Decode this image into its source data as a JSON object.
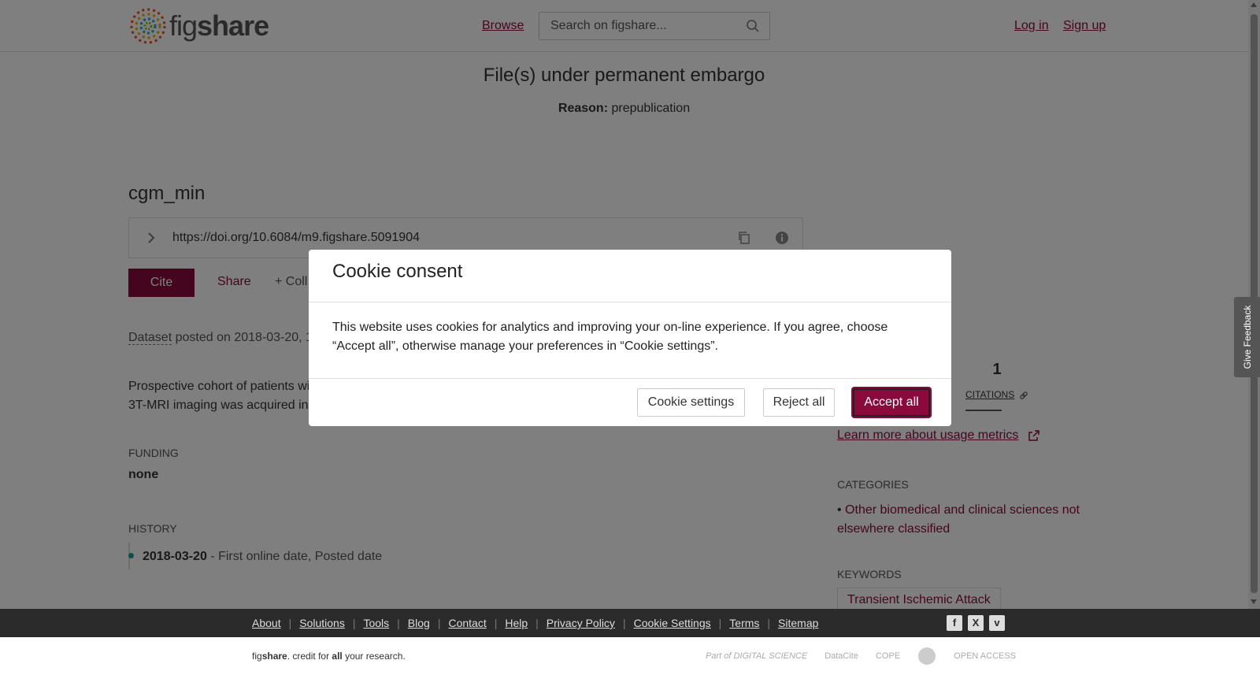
{
  "header": {
    "logo_text_fig": "fig",
    "logo_text_share": "share",
    "browse": "Browse",
    "search_placeholder": "Search on figshare...",
    "login": "Log in",
    "signup": "Sign up"
  },
  "embargo": {
    "title": "File(s) under permanent embargo",
    "reason_label": "Reason:",
    "reason_value": "prepublication"
  },
  "item": {
    "title": "cgm_min",
    "doi": "https://doi.org/10.6084/m9.figshare.5091904",
    "actions": {
      "cite": "Cite",
      "share": "Share",
      "collect": "+ Coll"
    },
    "type": "Dataset",
    "posted_prefix": " posted on 2018-03-20, 1",
    "description_lines": [
      "Prospective cohort of patients wi",
      "3T-MRI imaging was acquired in"
    ]
  },
  "funding": {
    "label": "FUNDING",
    "value": "none"
  },
  "history": {
    "label": "HISTORY",
    "date": "2018-03-20",
    "desc": " - First online date, Posted date"
  },
  "metrics": {
    "citations_count": "1",
    "citations_label": "CITATIONS",
    "learn_more": "Learn more about usage metrics"
  },
  "categories": {
    "label": "CATEGORIES",
    "item": "Other biomedical and clinical sciences not elsewhere classified"
  },
  "keywords": {
    "label": "KEYWORDS",
    "item": "Transient Ischemic Attack"
  },
  "feedback": "Give Feedback",
  "cookie": {
    "title": "Cookie consent",
    "body": "This website uses cookies for analytics and improving your on-line experience. If you agree, choose “Accept all”, otherwise manage your preferences in “Cookie settings”.",
    "settings": "Cookie settings",
    "reject": "Reject all",
    "accept": "Accept all"
  },
  "footer": {
    "links": [
      "About",
      "Solutions",
      "Tools",
      "Blog",
      "Contact",
      "Help",
      "Privacy Policy",
      "Cookie Settings",
      "Terms",
      "Sitemap"
    ],
    "social": [
      "f",
      "X",
      "v"
    ],
    "tagline_pre": "fig",
    "tagline_brand": "share",
    "tagline_mid": ". credit for ",
    "tagline_all": "all",
    "tagline_post": " your research.",
    "partners": [
      "Part of DIGITAL SCIENCE",
      "DataCite",
      "COPE",
      "",
      "OPEN ACCESS"
    ]
  },
  "colors": {
    "brand": "#8a0a3e",
    "footer_bg": "#2b2b2b",
    "history_dot": "#1a9ba6"
  },
  "icons": [
    "search-icon",
    "chevron-right-icon",
    "copy-icon",
    "info-icon",
    "link-icon",
    "external-link-icon"
  ]
}
